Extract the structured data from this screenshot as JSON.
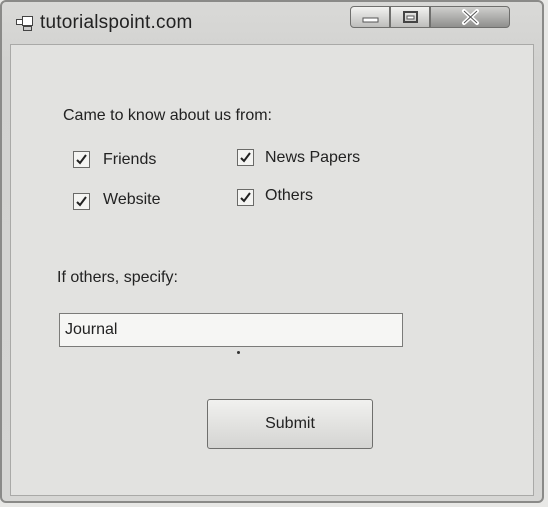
{
  "window": {
    "title": "tutorialspoint.com"
  },
  "form": {
    "heading": "Came to know about us from:",
    "checkboxes": [
      {
        "label": "Friends",
        "checked": true
      },
      {
        "label": "News Papers",
        "checked": true
      },
      {
        "label": "Website",
        "checked": true
      },
      {
        "label": "Others",
        "checked": true
      }
    ],
    "others_label": "If others, specify:",
    "others_value": "Journal",
    "submit_label": "Submit"
  }
}
